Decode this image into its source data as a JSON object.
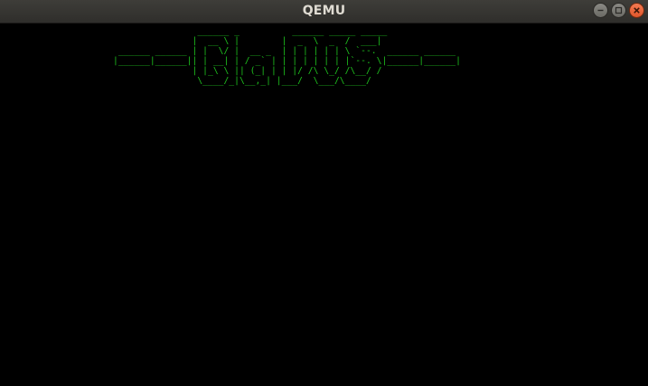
{
  "window": {
    "title": "QEMU",
    "controls": {
      "minimize_icon": "minimize-icon",
      "maximize_icon": "maximize-icon",
      "close_icon": "close-icon"
    }
  },
  "screen": {
    "background": "#000000",
    "text_color": "#1ec11e",
    "banner_lines": [
      "                ______ _          ______ _____ _____",
      "               |  __ \\ |        |  _  \\  _  /  ___|",
      " ______ ______ | |  \\/ |  __ _  | | | | | | \\ `--.  ______ ______",
      "|______|______|| | __| | / _` | | | | | | | |`--. \\|______|______|",
      "               | |_\\ \\ || (_| | | |/ /\\ \\_/ /\\__/ /",
      "                \\____/_|\\__,_| |___/  \\___/\\____/"
    ]
  }
}
